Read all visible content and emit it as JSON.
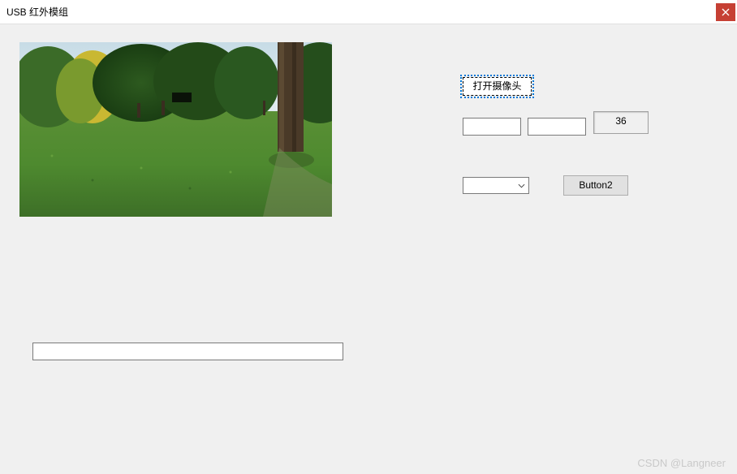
{
  "window": {
    "title": "USB 红外模组"
  },
  "controls": {
    "open_camera_label": "打开摄像头",
    "textbox1_value": "",
    "textbox2_value": "",
    "numeric_value": "36",
    "combobox_selected": "",
    "button2_label": "Button2",
    "status_value": ""
  },
  "watermark": "CSDN @Langneer"
}
